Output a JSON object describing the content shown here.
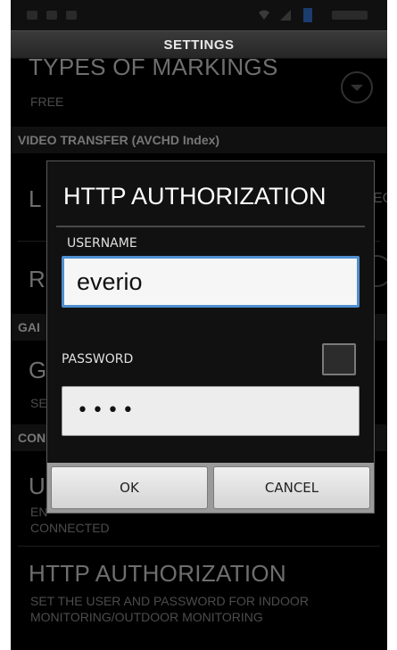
{
  "screen_title": "SETTINGS",
  "background_list": {
    "types_of_markings": {
      "title": "TYPES OF MARKINGS",
      "value": "FREE"
    },
    "video_transfer_header": "VIDEO TRANSFER (AVCHD Index)",
    "row_l_title_fragment": "L",
    "row_l_value_fragment": "EC",
    "row_r_title_fragment": "R",
    "section_gam_fragment": "GAI",
    "row_g_title_fragment": "G",
    "row_g_sub_fragment": "SE",
    "section_con_fragment": "CON",
    "row_u_title_fragment": "U",
    "row_u_sub1_fragment": "EN",
    "row_u_sub2_fragment": "CONNECTED",
    "http_authorization": {
      "title": "HTTP AUTHORIZATION",
      "description_line1": "SET THE USER AND PASSWORD FOR INDOOR",
      "description_line2": "MONITORING/OUTDOOR MONITORING"
    }
  },
  "dialog": {
    "title": "HTTP AUTHORIZATION",
    "username_label": "USERNAME",
    "username_value": "everio",
    "password_label": "PASSWORD",
    "password_value": "••••",
    "ok_label": "OK",
    "cancel_label": "CANCEL"
  },
  "colors": {
    "background": "#000000",
    "dialog_background": "#111111",
    "input_focus_border": "#4f8fcf"
  }
}
